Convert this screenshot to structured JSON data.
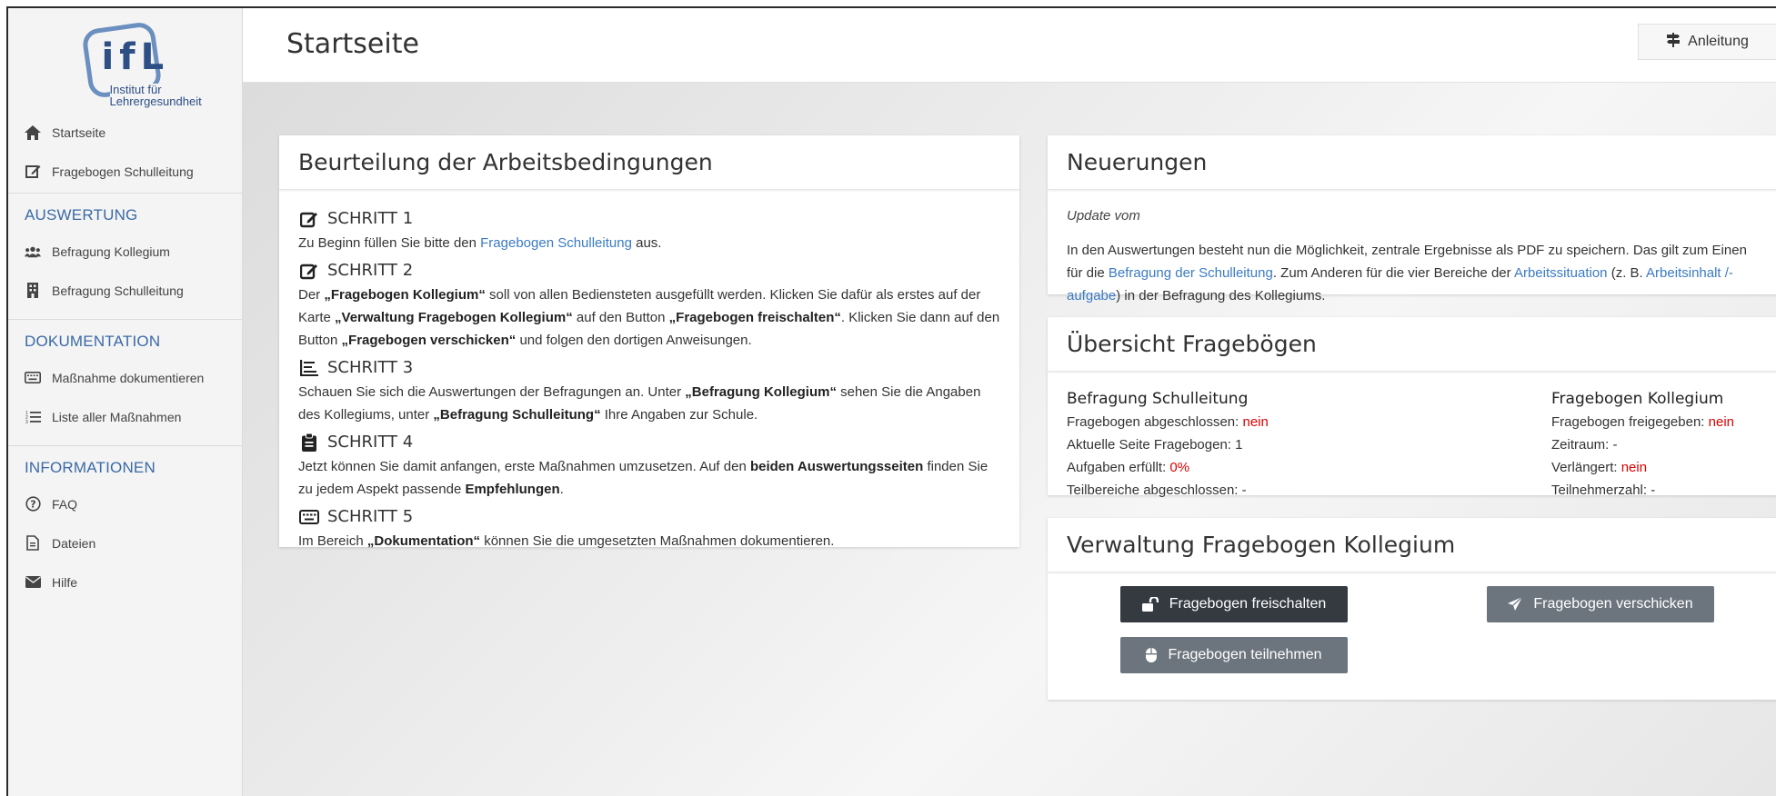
{
  "logo": {
    "letters": "ifL",
    "line1": "Institut für",
    "line2": "Lehrergesundheit"
  },
  "sidebar": {
    "items_top": [
      {
        "label": "Startseite",
        "icon": "home-icon"
      },
      {
        "label": "Fragebogen Schulleitung",
        "icon": "edit-icon"
      }
    ],
    "sections": [
      {
        "heading": "AUSWERTUNG",
        "items": [
          {
            "label": "Befragung Kollegium",
            "icon": "users-icon"
          },
          {
            "label": "Befragung Schulleitung",
            "icon": "building-icon"
          }
        ]
      },
      {
        "heading": "DOKUMENTATION",
        "items": [
          {
            "label": "Maßnahme dokumentieren",
            "icon": "keyboard-icon"
          },
          {
            "label": "Liste aller Maßnahmen",
            "icon": "list-ordered-icon"
          }
        ]
      },
      {
        "heading": "INFORMATIONEN",
        "items": [
          {
            "label": "FAQ",
            "icon": "question-circle-icon"
          },
          {
            "label": "Dateien",
            "icon": "file-icon"
          },
          {
            "label": "Hilfe",
            "icon": "envelope-icon"
          }
        ]
      }
    ]
  },
  "header": {
    "title": "Startseite",
    "guide_button": "Anleitung"
  },
  "steps_card": {
    "title": "Beurteilung der Arbeitsbedingungen",
    "steps": [
      {
        "title": "SCHRITT 1",
        "icon": "edit-icon",
        "text": {
          "a": "Zu Beginn füllen Sie bitte den ",
          "link": "Fragebogen Schulleitung",
          "b": " aus."
        }
      },
      {
        "title": "SCHRITT 2",
        "icon": "edit-icon",
        "text": {
          "a": "Der ",
          "b1": "„Fragebogen Kollegium“",
          "c": " soll von allen Bediensteten ausgefüllt werden. Klicken Sie dafür als erstes auf der Karte ",
          "b2": "„Verwaltung Fragebogen Kollegium“",
          "d": " auf den Button ",
          "b3": "„Fragebogen freischalten“",
          "e": ". Klicken Sie dann auf den Button ",
          "b4": "„Fragebogen verschicken“",
          "f": " und folgen den dortigen Anweisungen."
        }
      },
      {
        "title": "SCHRITT 3",
        "icon": "align-left-icon",
        "text": {
          "a": "Schauen Sie sich die Auswertungen der Befragungen an. Unter ",
          "b1": "„Befragung Kollegium“",
          "c": " sehen Sie die Angaben des Kollegiums, unter ",
          "b2": "„Befragung Schulleitung“",
          "d": " Ihre Angaben zur Schule."
        }
      },
      {
        "title": "SCHRITT 4",
        "icon": "clipboard-icon",
        "text": {
          "a": "Jetzt können Sie damit anfangen, erste Maßnahmen umzusetzen. Auf den ",
          "b1": "beiden Auswertungsseiten",
          "c": " finden Sie zu jedem Aspekt passende ",
          "b2": "Empfehlungen",
          "d": "."
        }
      },
      {
        "title": "SCHRITT 5",
        "icon": "keyboard-icon",
        "text": {
          "a": "Im Bereich ",
          "b1": "„Dokumentation“",
          "c": " können Sie die umgesetzten Maßnahmen dokumentieren."
        }
      }
    ]
  },
  "news_card": {
    "title": "Neuerungen",
    "update_label": "Update vom",
    "text": {
      "a": "In den Auswertungen besteht nun die Möglichkeit, zentrale Ergebnisse als PDF zu speichern. Das gilt zum Einen für die ",
      "link1": "Befragung der Schulleitung",
      "b": ". Zum Anderen für die vier Bereiche der ",
      "link2": "Arbeitssituation",
      "c": " (z. B. ",
      "link3": "Arbeitsinhalt /-aufgabe",
      "d": ") in der Befragung des Kollegiums."
    }
  },
  "overview_card": {
    "title": "Übersicht Fragebögen",
    "left": {
      "heading": "Befragung Schulleitung",
      "rows": [
        {
          "label": "Fragebogen abgeschlossen: ",
          "value": "nein",
          "red": true
        },
        {
          "label": "Aktuelle Seite Fragebogen: ",
          "value": "1",
          "red": false
        },
        {
          "label": "Aufgaben erfüllt: ",
          "value": "0%",
          "red": true
        },
        {
          "label": "Teilbereiche abgeschlossen: ",
          "value": "-",
          "red": false
        }
      ]
    },
    "right": {
      "heading": "Fragebogen Kollegium",
      "rows": [
        {
          "label": "Fragebogen freigegeben: ",
          "value": "nein",
          "red": true
        },
        {
          "label": "Zeitraum: ",
          "value": "-",
          "red": false
        },
        {
          "label": "Verlängert: ",
          "value": "nein",
          "red": true
        },
        {
          "label": "Teilnehmerzahl: ",
          "value": "-",
          "red": false
        }
      ]
    }
  },
  "admin_card": {
    "title": "Verwaltung Fragebogen Kollegium",
    "unlock_button": "Fragebogen freischalten",
    "send_button": "Fragebogen verschicken",
    "participate_button": "Fragebogen teilnehmen"
  },
  "colors": {
    "accent_blue": "#3a7bc4",
    "heading_blue": "#3b6aa6",
    "alert_red": "#e00000",
    "button_dark": "#343a40",
    "button_gray": "#6c757d"
  }
}
